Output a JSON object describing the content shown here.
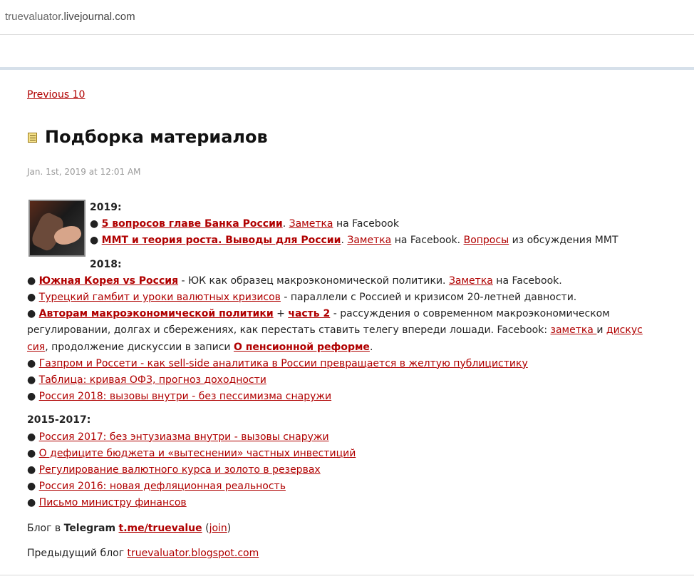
{
  "browser": {
    "url_host": "truevaluator",
    "url_rest": ".livejournal.com"
  },
  "nav": {
    "previous_label": "Previous 10"
  },
  "entry": {
    "title": "Подборка материалов",
    "date": "Jan. 1st, 2019 at 12:01 AM"
  },
  "bullet": "●",
  "y2019": {
    "heading": "2019:",
    "items": [
      {
        "link": "5 вопросов главе Банка России",
        "sep": ". ",
        "note_link": "Заметка",
        "tail": " на Facebook"
      },
      {
        "link": "MMT и теория роста. Выводы для России",
        "sep": ". ",
        "note_link": "Заметка",
        "mid": " на Facebook. ",
        "q_link": "Вопросы",
        "tail": " из обсуждения MMT"
      }
    ]
  },
  "y2018": {
    "heading": "2018:",
    "item1": {
      "link": "Южная Корея vs Россия",
      "text": " - ЮК как образец макроэкономической политики. ",
      "note_link": "Заметка",
      "tail": " на Facebook."
    },
    "item2": {
      "link": "Турецкий гамбит и уроки валютных кризисов",
      "tail": " - параллели с Россией и кризисом 20-летней давности."
    },
    "item3": {
      "link1": "Авторам макроэкономической политики",
      "plus": " + ",
      "link2": "часть 2",
      "text1": " - рассуждения о современном макроэкономическом",
      "text2": "регулировании, долгах и сбережениях, как перестать ставить телегу впереди лошади. Facebook: ",
      "fb_link1": "заметка ",
      "and": "и ",
      "fb_link2a": "дискус",
      "fb_link2b": "сия",
      "text3": ", продолжение дискуссии в записи ",
      "pension_link": "О пенсионной реформе",
      "end": "."
    },
    "item4": {
      "link": "Газпром и Россети - как sell-side аналитика в России превращается в желтую публицистику"
    },
    "item5": {
      "link": "Таблица: кривая ОФЗ, прогноз доходности"
    },
    "item6": {
      "link": "Россия 2018: вызовы внутри - без пессимизма снаружи"
    }
  },
  "y2015": {
    "heading": "2015-2017:",
    "items": [
      "Россия 2017: без энтузиазма внутри - вызовы снаружи",
      "О дефиците бюджета и «вытеснении» частных инвестиций",
      "Регулирование валютного курса и золото в резервах",
      "Россия 2016: новая дефляционная реальность",
      "Письмо министру финансов"
    ]
  },
  "telegram": {
    "pre": "Блог в ",
    "bold": "Telegram",
    "link": "t.me/truevalue",
    "open": " (",
    "join": "join",
    "close": ")"
  },
  "prev_blog": {
    "pre": "Предыдущий блог ",
    "link": "truevaluator.blogspot.com"
  }
}
